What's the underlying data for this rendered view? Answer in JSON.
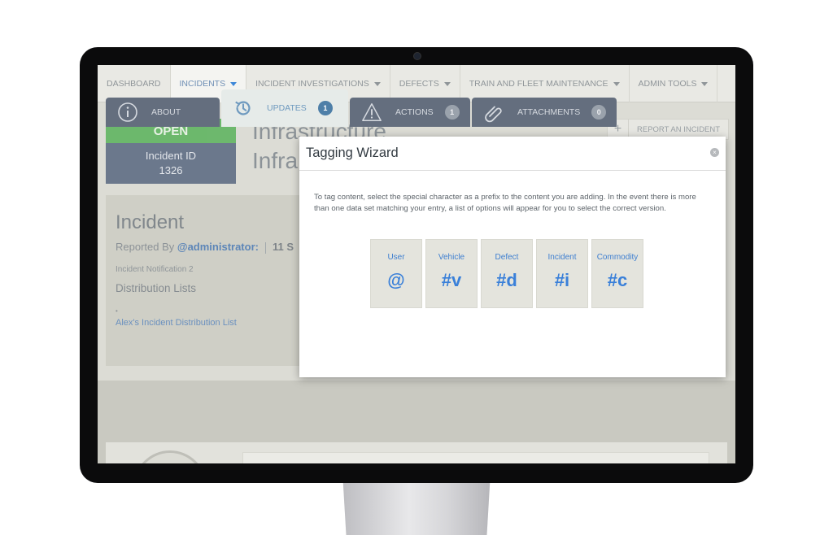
{
  "nav": {
    "items": [
      {
        "label": "DASHBOARD",
        "caret": false,
        "active": false
      },
      {
        "label": "INCIDENTS",
        "caret": true,
        "active": true
      },
      {
        "label": "INCIDENT INVESTIGATIONS",
        "caret": true,
        "active": false
      },
      {
        "label": "DEFECTS",
        "caret": true,
        "active": false
      },
      {
        "label": "TRAIN AND FLEET MAINTENANCE",
        "caret": true,
        "active": false
      },
      {
        "label": "ADMIN TOOLS",
        "caret": true,
        "active": false
      }
    ]
  },
  "status": {
    "label": "OPEN",
    "id_label": "Incident ID",
    "id_value": "1326",
    "color": "#59b25a"
  },
  "page": {
    "title_line_1": "Infrastructure",
    "title_line_2": "Infra",
    "report_button": "REPORT AN INCIDENT"
  },
  "incident_panel": {
    "heading": "Incident",
    "reported_by_label": "Reported By",
    "reported_by_user": "@administrator:",
    "reported_date": "11 S",
    "notification": "Incident Notification 2",
    "distribution_heading": "Distribution Lists",
    "bullet": "•",
    "distribution_link": "Alex's Incident Distribution List"
  },
  "modal": {
    "title": "Tagging Wizard",
    "close_glyph": "×",
    "instructions": "To tag content, select the special character as a prefix to the content you are adding. In the event there is more than one data set matching your entry, a list of options will appear for you to select the correct version.",
    "tags": [
      {
        "name": "User",
        "symbol": "@"
      },
      {
        "name": "Vehicle",
        "symbol": "#v"
      },
      {
        "name": "Defect",
        "symbol": "#d"
      },
      {
        "name": "Incident",
        "symbol": "#i"
      },
      {
        "name": "Commodity",
        "symbol": "#c"
      }
    ],
    "accent_color": "#3a80d9"
  },
  "tabs": [
    {
      "label": "ABOUT",
      "icon": "info-icon",
      "count": null,
      "active": false
    },
    {
      "label": "UPDATES",
      "icon": "history-icon",
      "count": "1",
      "active": true
    },
    {
      "label": "ACTIONS",
      "icon": "warning-icon",
      "count": "1",
      "active": false
    },
    {
      "label": "ATTACHMENTS",
      "icon": "paperclip-icon",
      "count": "0",
      "active": false
    }
  ]
}
